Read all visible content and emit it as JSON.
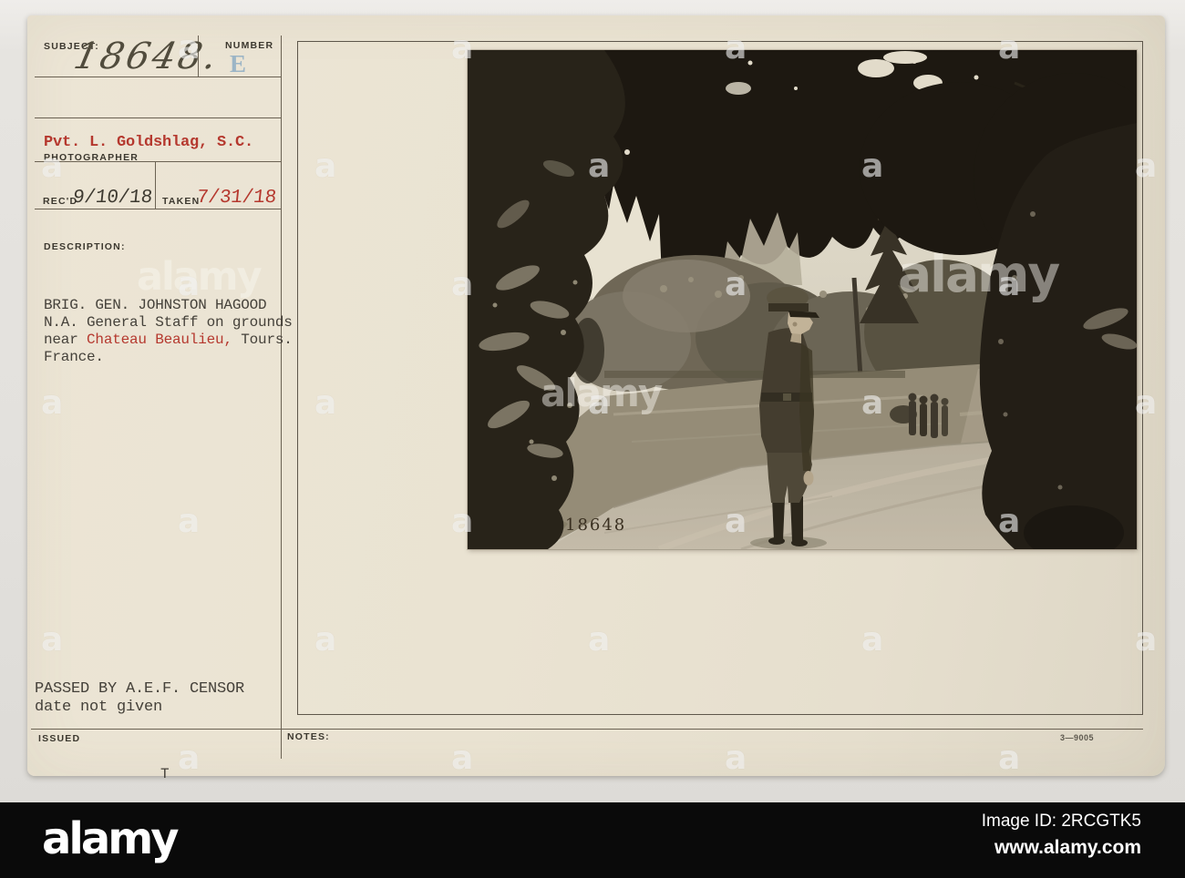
{
  "card": {
    "subject_label": "SUBJECT:",
    "subject_number": "18648.",
    "number_label": "NUMBER",
    "number_stamp": "E",
    "photographer_name": "Pvt. L. Goldshlag, S.C.",
    "photographer_label": "PHOTOGRAPHER",
    "recd_label": "REC'D",
    "recd_date": "9/10/18",
    "taken_label": "TAKEN",
    "taken_date": "7/31/18",
    "description_label": "DESCRIPTION:",
    "description_line1": "BRIG. GEN. JOHNSTON HAGOOD",
    "description_line2": "N.A. General Staff on grounds",
    "description_line3_pre": "near ",
    "description_line3_red": "Chateau Beaulieu,",
    "description_line3_post": " Tours.",
    "description_line4": "France.",
    "censor_line1": "PASSED BY A.E.F. CENSOR",
    "censor_line2": "date not given",
    "issued_label": "ISSUED",
    "notes_label": "NOTES:",
    "print_code": "3—9005",
    "typed_t": "T",
    "photo_number": "18648"
  },
  "footer": {
    "logo": "alamy",
    "image_id": "Image ID: 2RCGTK5",
    "website": "www.alamy.com"
  },
  "watermark": {
    "letter": "a",
    "word": "alamy"
  },
  "colors": {
    "typewriter_red": "#b5382e",
    "stamp_blue": "#8fadc4",
    "ink": "#45413a",
    "card_paper": "#eae3d2",
    "footer_black": "#0a0a0a"
  }
}
